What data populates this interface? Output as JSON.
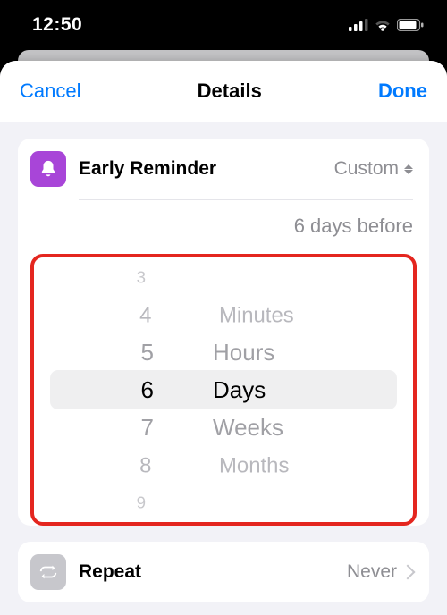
{
  "status": {
    "time": "12:50"
  },
  "nav": {
    "cancel": "Cancel",
    "title": "Details",
    "done": "Done"
  },
  "early_reminder": {
    "label": "Early Reminder",
    "value_label": "Custom",
    "summary": "6 days before"
  },
  "picker": {
    "numbers": {
      "m3": "3",
      "m2": "4",
      "m1": "5",
      "sel": "6",
      "p1": "7",
      "p2": "8",
      "p3": "9"
    },
    "units": {
      "m2": "Minutes",
      "m1": "Hours",
      "sel": "Days",
      "p1": "Weeks",
      "p2": "Months"
    },
    "selected_number": 6,
    "selected_unit": "Days"
  },
  "repeat": {
    "label": "Repeat",
    "value": "Never"
  }
}
